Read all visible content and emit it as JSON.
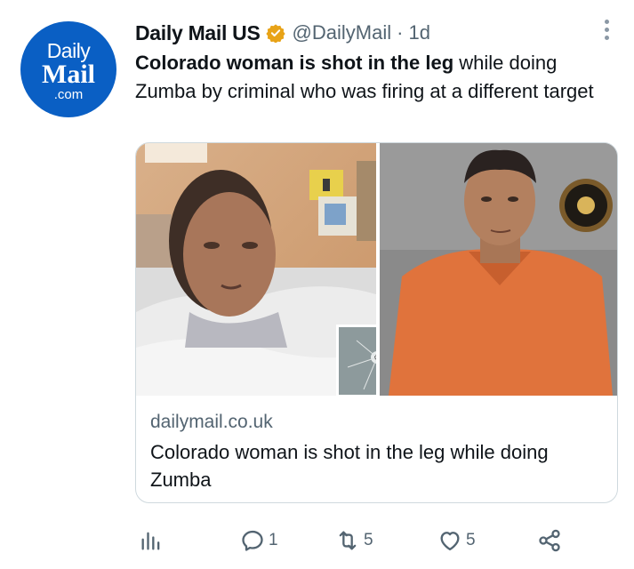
{
  "account": {
    "avatar_lines": [
      "Daily",
      "Mail",
      ".com"
    ],
    "name": "Daily Mail US",
    "handle": "@DailyMail",
    "separator": "·",
    "time": "1d",
    "verified_color": "#e8a317"
  },
  "tweet": {
    "bold_text": "Colorado woman is shot in the leg",
    "rest_text": " while doing Zumba by criminal who was firing at a different target"
  },
  "card": {
    "domain": "dailymail.co.uk",
    "title": "Colorado woman is shot in the leg while doing Zumba"
  },
  "actions": {
    "views": {
      "icon": "views-icon"
    },
    "reply": {
      "icon": "reply-icon",
      "count": "1"
    },
    "retweet": {
      "icon": "retweet-icon",
      "count": "5"
    },
    "like": {
      "icon": "heart-icon",
      "count": "5"
    },
    "share": {
      "icon": "share-icon"
    }
  },
  "colors": {
    "brand": "#0a5fc4",
    "muted": "#536471",
    "border": "#cfd9de"
  }
}
